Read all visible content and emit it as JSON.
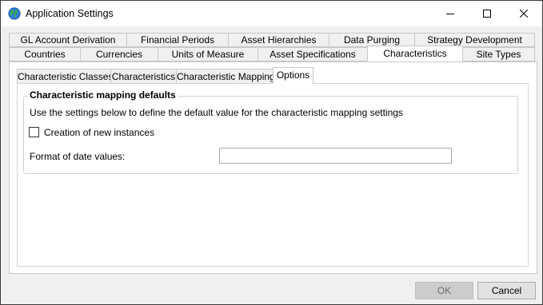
{
  "window": {
    "title": "Application Settings"
  },
  "tabs_row1": [
    {
      "label": "GL Account Derivation"
    },
    {
      "label": "Financial Periods"
    },
    {
      "label": "Asset Hierarchies"
    },
    {
      "label": "Data Purging"
    },
    {
      "label": "Strategy Development"
    }
  ],
  "tabs_row2": [
    {
      "label": "Countries"
    },
    {
      "label": "Currencies"
    },
    {
      "label": "Units of Measure"
    },
    {
      "label": "Asset Specifications"
    },
    {
      "label": "Characteristics",
      "selected": true
    },
    {
      "label": "Site Types"
    }
  ],
  "inner_tabs": [
    {
      "label": "Characteristic Classes"
    },
    {
      "label": "Characteristics"
    },
    {
      "label": "Characteristic Mapping"
    },
    {
      "label": "Options",
      "selected": true
    }
  ],
  "group": {
    "legend": "Characteristic mapping defaults",
    "description": "Use the settings below to define the default value for the characteristic mapping settings",
    "checkbox_label": "Creation of new instances",
    "checkbox_checked": false,
    "date_label": "Format of date values:",
    "date_value": ""
  },
  "buttons": {
    "ok": "OK",
    "cancel": "Cancel"
  },
  "icons": {
    "app": "globe-icon",
    "minimize": "minimize-icon",
    "maximize": "maximize-icon",
    "close": "close-icon"
  }
}
